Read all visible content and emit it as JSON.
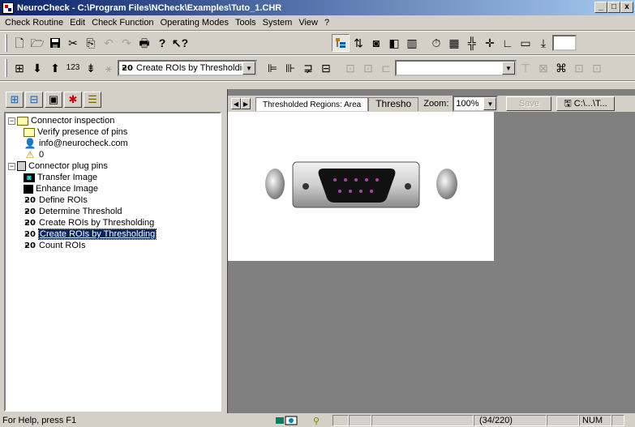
{
  "window": {
    "title": "NeuroCheck - C:\\Program Files\\NCheck\\Examples\\Tuto_1.CHR",
    "minimize": "_",
    "maximize": "□",
    "close": "x"
  },
  "menu": [
    {
      "label": "Check Routine",
      "key": "C"
    },
    {
      "label": "Edit",
      "key": "E"
    },
    {
      "label": "Check Function",
      "key": "F"
    },
    {
      "label": "Operating Modes",
      "key": "O"
    },
    {
      "label": "Tools",
      "key": "T"
    },
    {
      "label": "System",
      "key": "S"
    },
    {
      "label": "View",
      "key": "V"
    },
    {
      "label": "?",
      "key": "?"
    }
  ],
  "toolbar1": {
    "icons": [
      "new-icon",
      "open-icon",
      "save-icon",
      "cut-icon",
      "copy-icon",
      "undo-icon",
      "redo-icon",
      "print-icon",
      "help-icon",
      "context-help-icon"
    ],
    "right_icons": [
      "tree-view-icon",
      "transfer-icon",
      "camera-icon",
      "split-icon",
      "columns-icon",
      "timer-icon",
      "grid-icon",
      "crosshair-icon",
      "plus-icon",
      "angle-icon",
      "display-icon",
      "export-icon"
    ],
    "right_value": ""
  },
  "toolbar2": {
    "combo_icon": "roi-icon",
    "combo_value": "Create ROIs by Thresholding",
    "combo2_value": ""
  },
  "tree": {
    "items": [
      {
        "label": "Connector inspection"
      },
      {
        "label": "Verify presence of pins"
      },
      {
        "label": "info@neurocheck.com"
      },
      {
        "label": "0"
      },
      {
        "label": "Connector plug pins"
      },
      {
        "label": "Transfer Image"
      },
      {
        "label": "Enhance Image"
      },
      {
        "label": "Define ROIs"
      },
      {
        "label": "Determine Threshold"
      },
      {
        "label": "Create ROIs by Thresholding"
      },
      {
        "label": "Create ROIs by Thresholding"
      },
      {
        "label": "Count ROIs"
      }
    ]
  },
  "image_panel": {
    "tab_active": "Thresholded Regions: Area",
    "tab_inactive": "Thresho",
    "zoom_label": "Zoom:",
    "zoom_value": "100%",
    "save_label": "Save",
    "path_label": "C:\\...\\T..."
  },
  "status": {
    "help": "For Help, press F1",
    "counter": "(34/220)",
    "num": "NUM"
  },
  "colors": {
    "selection": "#0a246a",
    "title_start": "#0a246a",
    "title_end": "#a6caf0"
  }
}
